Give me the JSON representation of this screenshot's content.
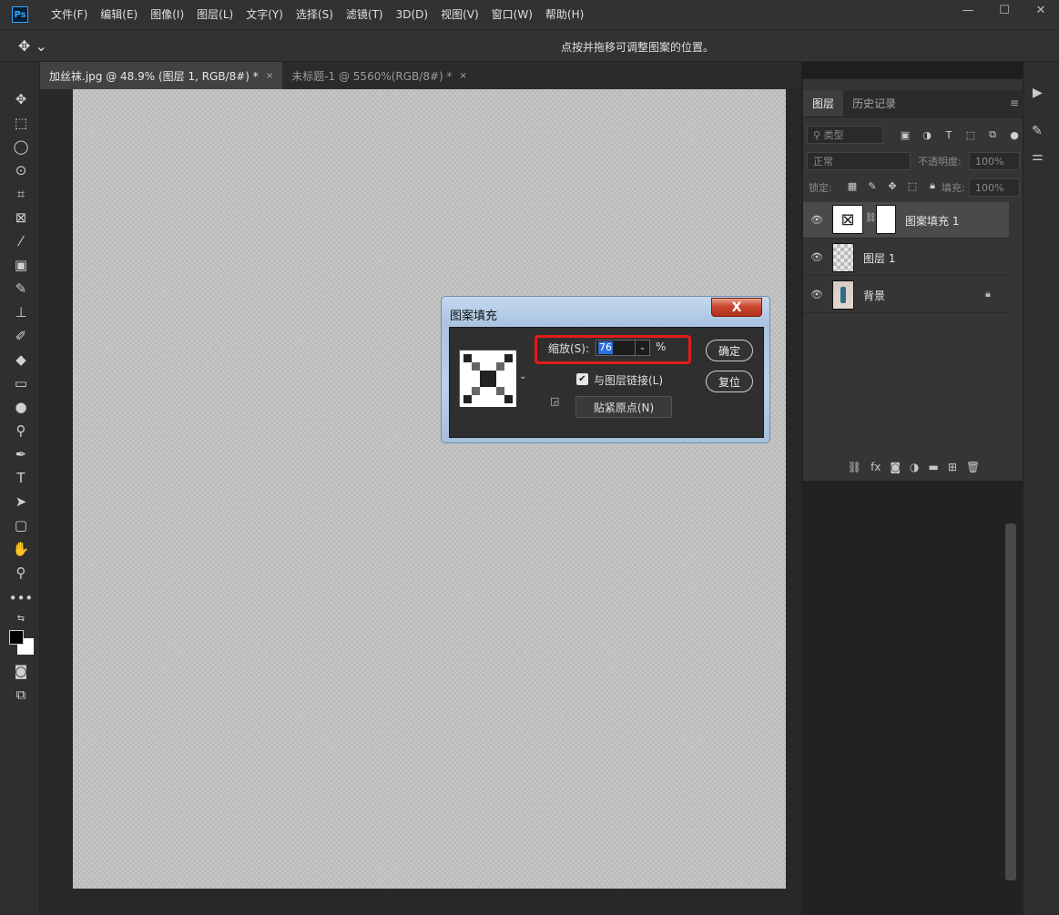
{
  "app": {
    "logo": "Ps"
  },
  "menu": [
    "文件(F)",
    "编辑(E)",
    "图像(I)",
    "图层(L)",
    "文字(Y)",
    "选择(S)",
    "滤镜(T)",
    "3D(D)",
    "视图(V)",
    "窗口(W)",
    "帮助(H)"
  ],
  "window_controls": {
    "minimize": "—",
    "maximize": "☐",
    "close": "✕"
  },
  "options_bar": {
    "hint": "点按并拖移可调整图案的位置。"
  },
  "tabs": [
    {
      "label": "加丝袜.jpg @ 48.9% (图层 1, RGB/8#) *",
      "close": "×"
    },
    {
      "label": "未标题-1 @ 5560%(RGB/8#) *",
      "close": "×"
    }
  ],
  "layers_panel": {
    "tabs": [
      "图层",
      "历史记录"
    ],
    "filter_placeholder": "类型",
    "blend_mode": "正常",
    "opacity_label": "不透明度:",
    "opacity_value": "100%",
    "lock_label": "锁定:",
    "fill_label": "填充:",
    "fill_value": "100%",
    "layers": [
      {
        "name": "图案填充 1",
        "selected": true
      },
      {
        "name": "图层 1",
        "selected": false
      },
      {
        "name": "背景",
        "selected": false,
        "locked": true
      }
    ]
  },
  "dialog": {
    "title": "图案填充",
    "close_label": "X",
    "scale_label": "缩放(S):",
    "scale_value": "76",
    "scale_unit": "%",
    "link_label": "与图层链接(L)",
    "link_checked": true,
    "snap_label": "贴紧原点(N)",
    "ok_label": "确定",
    "reset_label": "复位"
  }
}
